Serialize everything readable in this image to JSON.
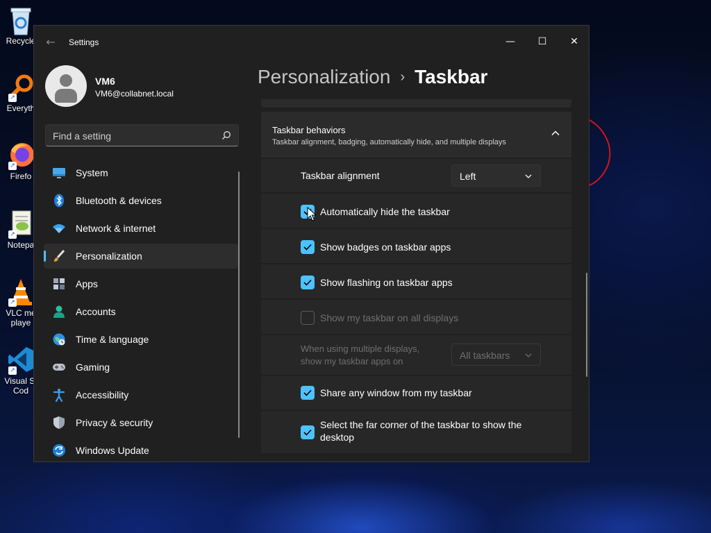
{
  "desktop": {
    "icons": [
      {
        "label": "Recycle",
        "icon": "recycle-bin-icon"
      },
      {
        "label": "Everyth",
        "icon": "everything-search-icon"
      },
      {
        "label": "Firefo",
        "icon": "firefox-icon"
      },
      {
        "label": "Notepa",
        "icon": "notepad-plus-plus-icon"
      },
      {
        "label": "VLC me",
        "label2": "playe",
        "icon": "vlc-icon"
      },
      {
        "label": "Visual St",
        "label2": "Cod",
        "icon": "vscode-icon"
      }
    ]
  },
  "window": {
    "title": "Settings",
    "back_icon": "back-arrow-icon",
    "controls": {
      "minimize": "—",
      "maximize": "☐",
      "close": "✕"
    }
  },
  "profile": {
    "name": "VM6",
    "email": "VM6@collabnet.local"
  },
  "search": {
    "placeholder": "Find a setting"
  },
  "nav": {
    "items": [
      {
        "label": "System",
        "icon": "system-monitor-icon"
      },
      {
        "label": "Bluetooth & devices",
        "icon": "bluetooth-icon"
      },
      {
        "label": "Network & internet",
        "icon": "wifi-icon"
      },
      {
        "label": "Personalization",
        "icon": "paintbrush-icon",
        "active": true
      },
      {
        "label": "Apps",
        "icon": "apps-icon"
      },
      {
        "label": "Accounts",
        "icon": "accounts-icon"
      },
      {
        "label": "Time & language",
        "icon": "globe-clock-icon"
      },
      {
        "label": "Gaming",
        "icon": "gamepad-icon"
      },
      {
        "label": "Accessibility",
        "icon": "accessibility-icon"
      },
      {
        "label": "Privacy & security",
        "icon": "shield-icon"
      },
      {
        "label": "Windows Update",
        "icon": "update-icon"
      }
    ]
  },
  "header": {
    "parent": "Personalization",
    "separator": "›",
    "current": "Taskbar"
  },
  "section": {
    "title": "Taskbar behaviors",
    "subtitle": "Taskbar alignment, badging, automatically hide, and multiple displays",
    "expanded": true
  },
  "settings": {
    "alignment": {
      "label": "Taskbar alignment",
      "value": "Left"
    },
    "auto_hide": {
      "label": "Automatically hide the taskbar",
      "checked": true
    },
    "badges": {
      "label": "Show badges on taskbar apps",
      "checked": true
    },
    "flashing": {
      "label": "Show flashing on taskbar apps",
      "checked": true
    },
    "all_displays": {
      "label": "Show my taskbar on all displays",
      "checked": false,
      "disabled": true
    },
    "multi_display": {
      "label_line1": "When using multiple displays,",
      "label_line2": "show my taskbar apps on",
      "value": "All taskbars",
      "disabled": true
    },
    "share_window": {
      "label": "Share any window from my taskbar",
      "checked": true
    },
    "far_corner": {
      "label_line1": "Select the far corner of the taskbar to show the",
      "label_line2": "desktop",
      "checked": true
    }
  },
  "colors": {
    "accent": "#4cc2ff",
    "window_bg": "#202020",
    "card_bg": "#272727"
  }
}
